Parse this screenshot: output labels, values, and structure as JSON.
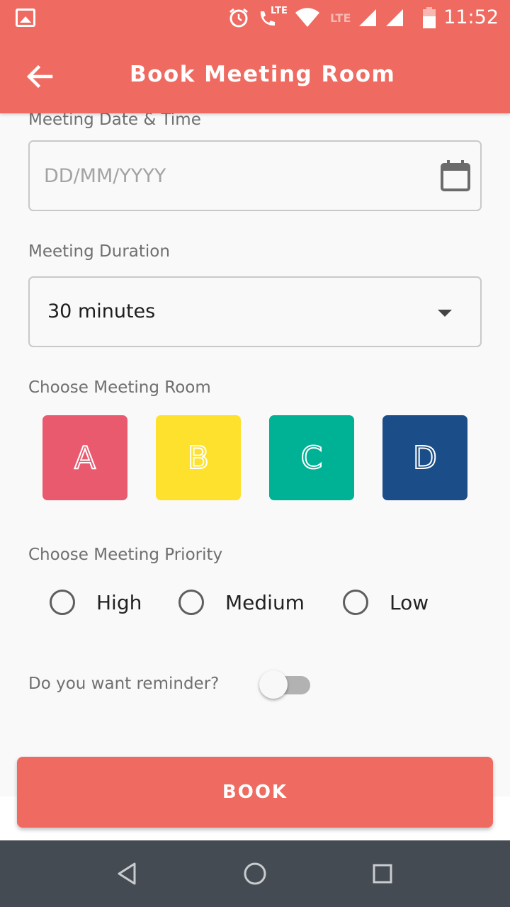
{
  "status_bar": {
    "time": "11:52",
    "lte_label": "LTE",
    "icons": [
      "image-icon",
      "alarm-icon",
      "lte-call-icon",
      "wifi-icon",
      "signal-icon",
      "signal-icon",
      "battery-icon"
    ]
  },
  "app_bar": {
    "title": "Book Meeting Room",
    "back_icon": "arrow-left-icon",
    "color": "#ef6a60"
  },
  "form": {
    "date_time": {
      "label": "Meeting Date & Time",
      "placeholder": "DD/MM/YYYY",
      "value": ""
    },
    "duration": {
      "label": "Meeting Duration",
      "selected": "30 minutes"
    },
    "rooms": {
      "label": "Choose Meeting Room",
      "items": [
        {
          "letter": "A",
          "color": "#ea5a6f"
        },
        {
          "letter": "B",
          "color": "#fde12d"
        },
        {
          "letter": "C",
          "color": "#00b295"
        },
        {
          "letter": "D",
          "color": "#1b4e89"
        }
      ]
    },
    "priority": {
      "label": "Choose Meeting Priority",
      "options": [
        "High",
        "Medium",
        "Low"
      ],
      "selected": null
    },
    "reminder": {
      "label": "Do you want reminder?",
      "enabled": false
    }
  },
  "book_button": {
    "label": "BOOK"
  },
  "nav_bar": {
    "icons": [
      "back-triangle-icon",
      "home-circle-icon",
      "recents-square-icon"
    ]
  }
}
